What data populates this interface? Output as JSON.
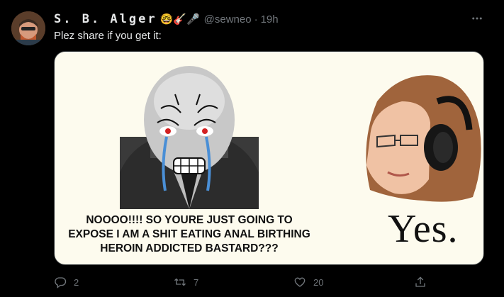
{
  "tweet": {
    "display_name": "S. B. Alger",
    "name_emojis": "🤓🎸🎤",
    "handle": "@sewneo",
    "separator": "·",
    "timestamp": "19h",
    "text": "Plez share if you get it:",
    "more_icon": "more-horizontal-icon"
  },
  "media": {
    "caption_lines": [
      "NOOOO!!!! SO YOURE JUST GOING TO",
      "EXPOSE I AM A SHIT EATING ANAL BIRTHING",
      "HEROIN ADDICTED BASTARD???"
    ],
    "response": "Yes.",
    "background_color": "#fdfbee"
  },
  "actions": {
    "reply": {
      "icon": "reply-icon",
      "count": "2"
    },
    "retweet": {
      "icon": "retweet-icon",
      "count": "7"
    },
    "like": {
      "icon": "heart-icon",
      "count": "20"
    },
    "share": {
      "icon": "share-icon"
    }
  },
  "colors": {
    "background": "#000000",
    "primary_text": "#e7e9ea",
    "secondary_text": "#71767b",
    "border": "#2f3336"
  }
}
